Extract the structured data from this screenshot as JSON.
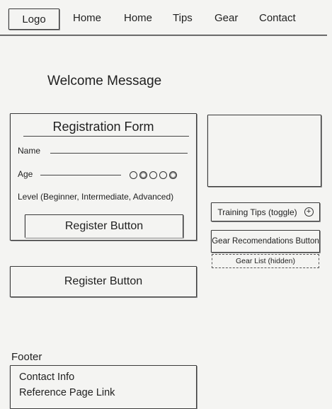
{
  "nav": {
    "logo": "Logo",
    "items": [
      "Home",
      "Home",
      "Tips",
      "Gear",
      "Contact"
    ]
  },
  "welcome": "Welcome Message",
  "registration": {
    "title": "Registration Form",
    "name_label": "Name",
    "age_label": "Age",
    "level_label": "Level (Beginner, Intermediate, Advanced)",
    "register_button": "Register Button"
  },
  "register_button_secondary": "Register Button",
  "sidebar": {
    "training_tips": "Training Tips (toggle)",
    "training_tips_icon": "plus-circle-icon",
    "gear_button": "Gear Recomendations Button",
    "gear_list": "Gear List (hidden)"
  },
  "footer": {
    "label": "Footer",
    "contact": "Contact Info",
    "reference": "Reference Page Link"
  }
}
